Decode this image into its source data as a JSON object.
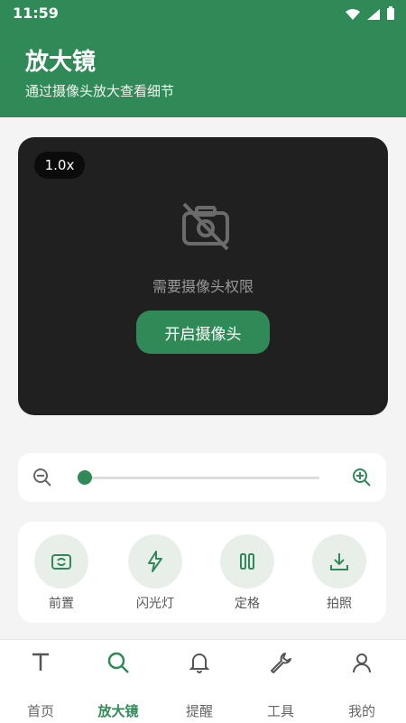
{
  "status": {
    "time": "11:59"
  },
  "header": {
    "title": "放大镜",
    "subtitle": "通过摄像头放大查看细节"
  },
  "camera": {
    "zoom": "1.0x",
    "permission_text": "需要摄像头权限",
    "open_button": "开启摄像头"
  },
  "zoom": {
    "level_fraction": 0.0
  },
  "tools": [
    {
      "label": "前置",
      "icon": "camera-switch-icon"
    },
    {
      "label": "闪光灯",
      "icon": "flash-icon"
    },
    {
      "label": "定格",
      "icon": "pause-icon"
    },
    {
      "label": "拍照",
      "icon": "download-icon"
    }
  ],
  "nav": [
    {
      "label": "首页",
      "icon": "text-icon"
    },
    {
      "label": "放大镜",
      "icon": "search-icon",
      "active": true
    },
    {
      "label": "提醒",
      "icon": "bell-icon"
    },
    {
      "label": "工具",
      "icon": "wrench-icon"
    },
    {
      "label": "我的",
      "icon": "user-icon"
    }
  ],
  "colors": {
    "primary": "#2f8a57",
    "camera_bg": "#202020",
    "page_bg": "#f3f4f3"
  }
}
